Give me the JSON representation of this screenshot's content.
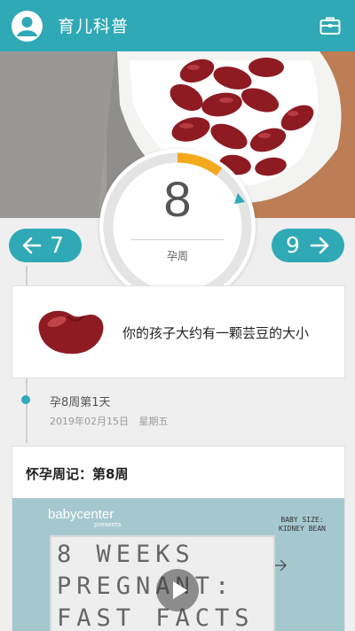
{
  "header": {
    "title": "育儿科普"
  },
  "icons": {
    "profile": "person-icon",
    "toolbox": "briefcase-icon"
  },
  "colors": {
    "accent": "#2fa9b6",
    "progress": "#f4a91d"
  },
  "week": {
    "current": "8",
    "label": "孕周",
    "prev": "7",
    "next": "9"
  },
  "size_card": {
    "text": "你的孩子大约有一颗芸豆的大小"
  },
  "date": {
    "title": "孕8周第1天",
    "date": "2019年02月15日",
    "weekday": "星期五"
  },
  "diary": {
    "title": "怀孕周记：第8周"
  },
  "video": {
    "brand": "babycenter",
    "presents": "presents",
    "baby_size": "BABY SIZE:",
    "baby_size_value": "KIDNEY BEAN",
    "board_lines": [
      "8 WEEKS",
      "PREGNANT:",
      "FAST FACTS"
    ]
  }
}
